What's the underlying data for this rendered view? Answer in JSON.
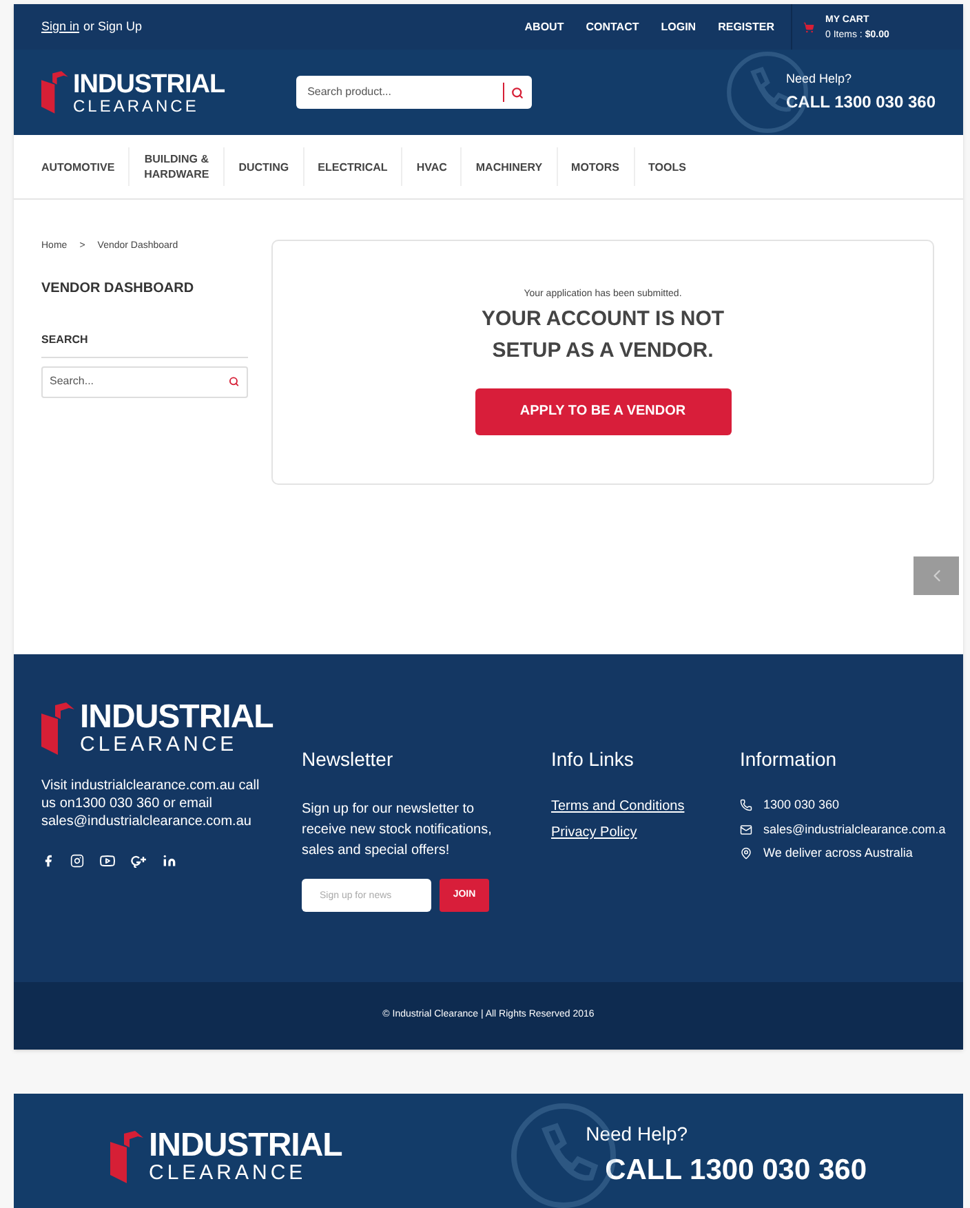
{
  "top_bar": {
    "sign_in": "Sign in",
    "sign_up": "or Sign Up",
    "links": [
      {
        "label": "ABOUT"
      },
      {
        "label": "CONTACT"
      },
      {
        "label": "LOGIN"
      },
      {
        "label": "REGISTER"
      }
    ],
    "cart": {
      "title": "MY CART",
      "items": "0 Items :",
      "total": "$0.00"
    }
  },
  "header": {
    "logo": {
      "line1": "INDUSTRIAL",
      "line2": "CLEARANCE"
    },
    "search": {
      "placeholder": "Search product..."
    },
    "help": {
      "label": "Need Help?",
      "phone": "CALL 1300 030 360"
    }
  },
  "nav": {
    "items": [
      {
        "label": "AUTOMOTIVE"
      },
      {
        "label": "BUILDING & HARDWARE"
      },
      {
        "label": "DUCTING"
      },
      {
        "label": "ELECTRICAL"
      },
      {
        "label": "HVAC"
      },
      {
        "label": "MACHINERY"
      },
      {
        "label": "MOTORS"
      },
      {
        "label": "TOOLS"
      }
    ]
  },
  "breadcrumb": [
    "Home",
    ">",
    "Vendor Dashboard"
  ],
  "sidebar": {
    "title": "VENDOR DASHBOARD",
    "search_heading": "SEARCH",
    "search": {
      "placeholder": "Search..."
    }
  },
  "notice": {
    "message": "Your application has been submitted.",
    "heading": "YOUR ACCOUNT IS NOT SETUP AS A VENDOR.",
    "button": "APPLY TO BE A VENDOR"
  },
  "footer": {
    "logo": {
      "line1": "INDUSTRIAL",
      "line2": "CLEARANCE"
    },
    "about": "Visit industrialclearance.com.au call us on1300 030 360 or email sales@industrialclearance.com.au",
    "newsletter": {
      "title": "Newsletter",
      "text": "Sign up for our newsletter to receive new stock notifications, sales and special offers!",
      "placeholder": "Sign up for news",
      "button": "JOIN"
    },
    "info_links": {
      "title": "Info Links",
      "links": [
        "Terms and Conditions",
        "Privacy Policy"
      ]
    },
    "information": {
      "title": "Information",
      "items": [
        {
          "kind": "phone",
          "text": "1300 030 360"
        },
        {
          "kind": "email",
          "text": "sales@industrialclearance.com.a"
        },
        {
          "kind": "location",
          "text": "We deliver across Australia"
        }
      ]
    },
    "copyright": "© Industrial Clearance | All Rights Reserved 2016"
  },
  "second_header": {
    "logo": {
      "line1": "INDUSTRIAL",
      "line2": "CLEARANCE"
    },
    "help": {
      "label": "Need Help?",
      "phone": "CALL 1300 030 360"
    }
  }
}
